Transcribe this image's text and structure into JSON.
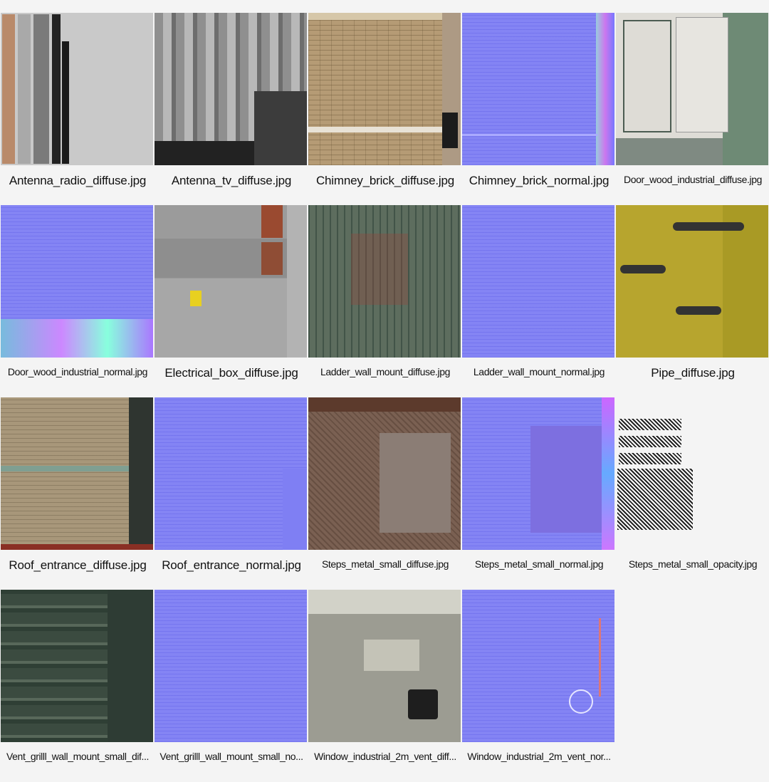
{
  "textures": [
    {
      "label": "Antenna_radio_diffuse.jpg",
      "style": "diff-grey",
      "size": "normal"
    },
    {
      "label": "Antenna_tv_diffuse.jpg",
      "style": "diff-tv",
      "size": "normal"
    },
    {
      "label": "Chimney_brick_diffuse.jpg",
      "style": "diff-brick",
      "size": "normal"
    },
    {
      "label": "Chimney_brick_normal.jpg",
      "style": "normal",
      "size": "normal"
    },
    {
      "label": "Door_wood_industrial_diffuse.jpg",
      "style": "diff-door",
      "size": "small"
    },
    {
      "label": "Door_wood_industrial_normal.jpg",
      "style": "normal",
      "size": "small"
    },
    {
      "label": "Electrical_box_diffuse.jpg",
      "style": "diff-elec",
      "size": "normal"
    },
    {
      "label": "Ladder_wall_mount_diffuse.jpg",
      "style": "diff-ladder",
      "size": "small"
    },
    {
      "label": "Ladder_wall_mount_normal.jpg",
      "style": "normal",
      "size": "small"
    },
    {
      "label": "Pipe_diffuse.jpg",
      "style": "diff-pipe",
      "size": "normal"
    },
    {
      "label": "Roof_entrance_diffuse.jpg",
      "style": "diff-roof",
      "size": "normal"
    },
    {
      "label": "Roof_entrance_normal.jpg",
      "style": "normal",
      "size": "normal"
    },
    {
      "label": "Steps_metal_small_diffuse.jpg",
      "style": "diff-steps",
      "size": "small"
    },
    {
      "label": "Steps_metal_small_normal.jpg",
      "style": "normal",
      "size": "small"
    },
    {
      "label": "Steps_metal_small_opacity.jpg",
      "style": "opacity",
      "size": "small"
    },
    {
      "label": "Vent_grilll_wall_mount_small_dif...",
      "style": "diff-vent",
      "size": "small"
    },
    {
      "label": "Vent_grilll_wall_mount_small_no...",
      "style": "normal",
      "size": "small"
    },
    {
      "label": "Window_industrial_2m_vent_diff...",
      "style": "diff-window",
      "size": "small"
    },
    {
      "label": "Window_industrial_2m_vent_nor...",
      "style": "normal",
      "size": "small"
    }
  ]
}
